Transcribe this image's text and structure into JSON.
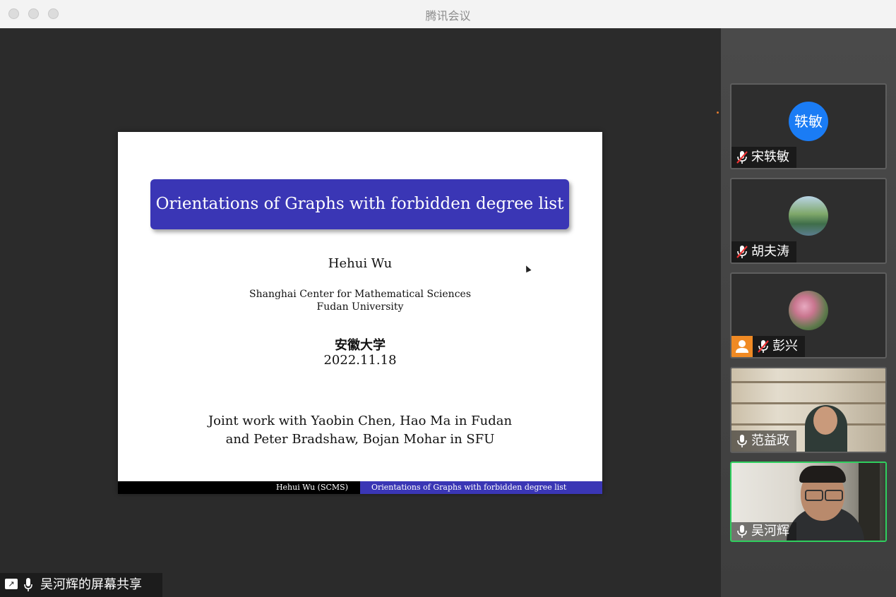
{
  "window": {
    "title": "腾讯会议"
  },
  "slide": {
    "title": "Orientations of Graphs with forbidden degree list",
    "author": "Hehui Wu",
    "affiliation_line1": "Shanghai Center for Mathematical Sciences",
    "affiliation_line2": "Fudan University",
    "venue": "安徽大学",
    "date": "2022.11.18",
    "joint_line1": "Joint work with Yaobin Chen, Hao Ma in Fudan",
    "joint_line2": "and Peter Bradshaw, Bojan Mohar in SFU",
    "footer_left": "Hehui Wu (SCMS)",
    "footer_right": "Orientations of Graphs with forbidden degree list"
  },
  "share": {
    "label": "吴河辉的屏幕共享"
  },
  "participants": [
    {
      "name": "宋轶敏",
      "avatar_text": "轶敏",
      "avatar_color": "#1a7cf5",
      "muted": true
    },
    {
      "name": "胡夫涛",
      "avatar_type": "photo-landscape",
      "muted": true
    },
    {
      "name": "彭兴",
      "avatar_type": "photo-flowers",
      "muted": true,
      "has_person_badge": true
    },
    {
      "name": "范益政",
      "avatar_type": "video",
      "muted": false
    },
    {
      "name": "吴河辉",
      "avatar_type": "video",
      "muted": false,
      "speaking": true
    }
  ],
  "colors": {
    "accent": "#3a36b5",
    "speaking_border": "#2fcf5e"
  }
}
